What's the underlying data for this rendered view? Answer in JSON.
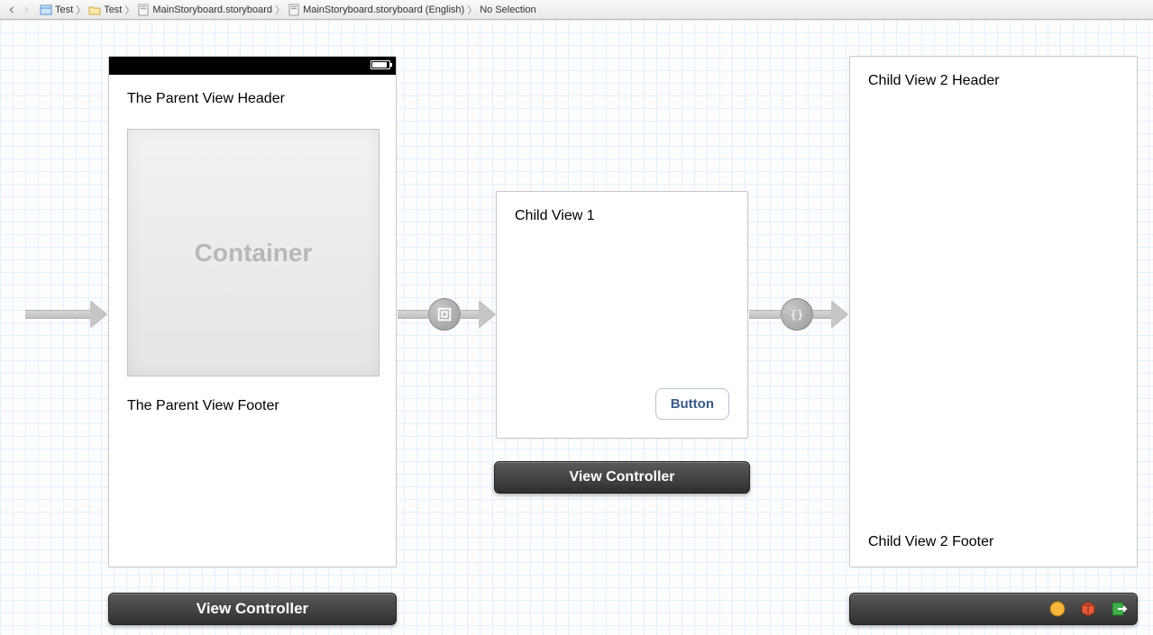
{
  "breadcrumb": {
    "items": [
      {
        "label": "Test",
        "icon": "project-icon"
      },
      {
        "label": "Test",
        "icon": "folder-icon"
      },
      {
        "label": "MainStoryboard.storyboard",
        "icon": "storyboard-icon"
      },
      {
        "label": "MainStoryboard.storyboard (English)",
        "icon": "storyboard-icon"
      },
      {
        "label": "No Selection",
        "icon": ""
      }
    ]
  },
  "scene1": {
    "header": "The Parent View Header",
    "container": "Container",
    "footer": "The Parent View Footer",
    "dock": "View Controller"
  },
  "scene2": {
    "title": "Child View 1",
    "button": "Button",
    "dock": "View Controller"
  },
  "scene3": {
    "header": "Child View 2 Header",
    "footer": "Child View 2 Footer"
  },
  "segue": {
    "type_embed": "embed-segue",
    "type_custom": "custom-segue"
  }
}
